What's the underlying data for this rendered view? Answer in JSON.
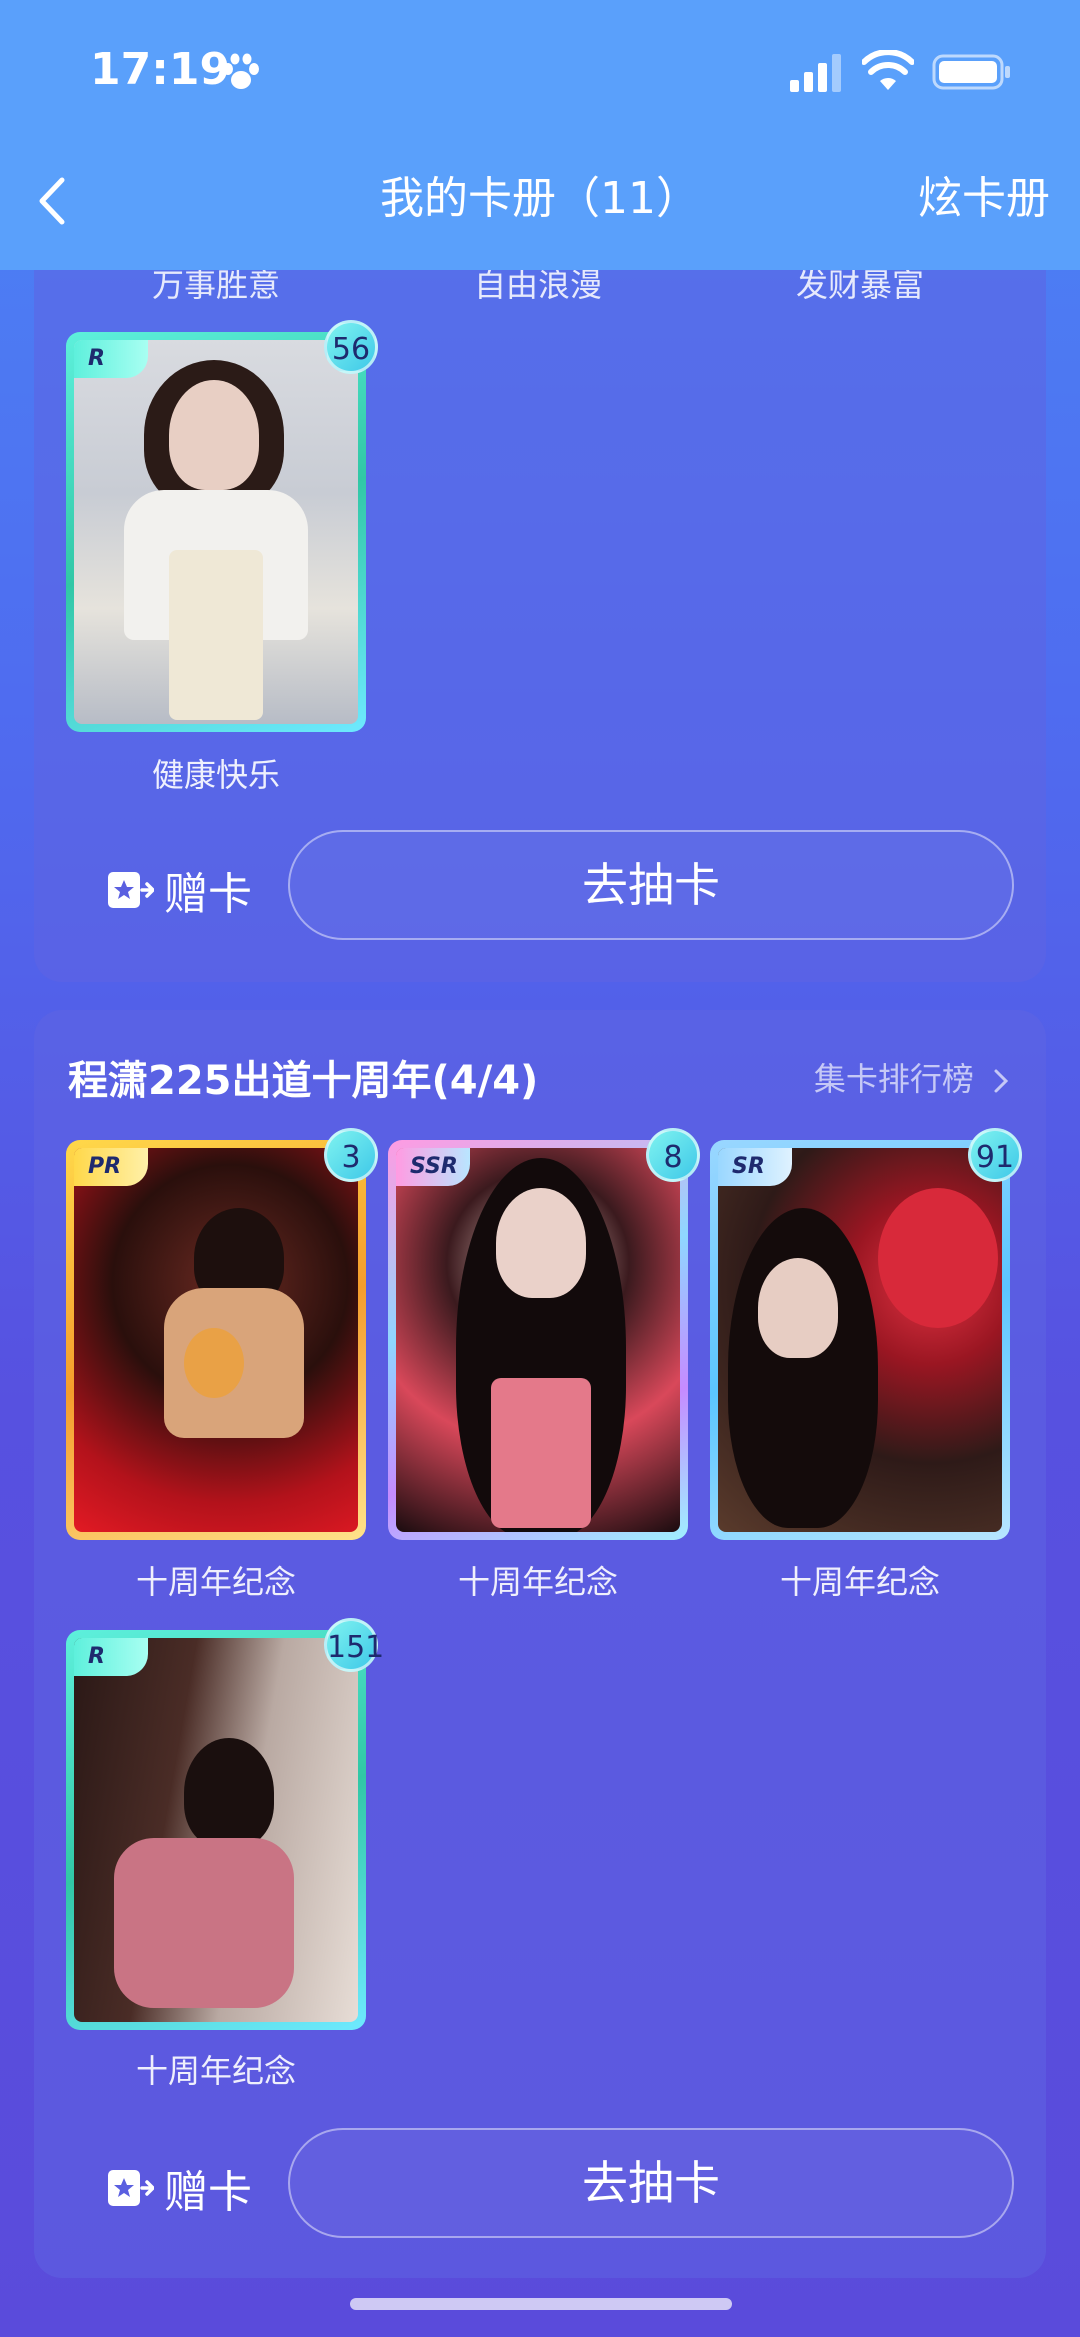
{
  "status_bar": {
    "time": "17:19",
    "icons": [
      "paw-icon",
      "signal-icon",
      "wifi-icon",
      "battery-icon"
    ]
  },
  "nav": {
    "back_icon": "chevron-left-icon",
    "title": "我的卡册（11）",
    "right_action": "炫卡册"
  },
  "section1": {
    "cut_labels": [
      "万事胜意",
      "自由浪漫",
      "发财暴富"
    ],
    "cards": [
      {
        "rarity": "R",
        "count": "56",
        "label": "健康快乐"
      }
    ],
    "gift_label": "赠卡",
    "draw_label": "去抽卡"
  },
  "section2": {
    "title": "程潇225出道十周年(4/4)",
    "rank_link": "集卡排行榜",
    "cards": [
      {
        "rarity": "PR",
        "count": "3",
        "label": "十周年纪念"
      },
      {
        "rarity": "SSR",
        "count": "8",
        "label": "十周年纪念"
      },
      {
        "rarity": "SR",
        "count": "91",
        "label": "十周年纪念"
      },
      {
        "rarity": "R",
        "count": "151",
        "label": "十周年纪念"
      }
    ],
    "gift_label": "赠卡",
    "draw_label": "去抽卡"
  },
  "colors": {
    "header_bg": "#5aa0fb",
    "rarity_r": "#5ef0dc",
    "rarity_pr": "#ffd84a",
    "rarity_ssr": "#ff9be2",
    "rarity_sr": "#9ad7ff",
    "badge": "#7ff3f0"
  }
}
